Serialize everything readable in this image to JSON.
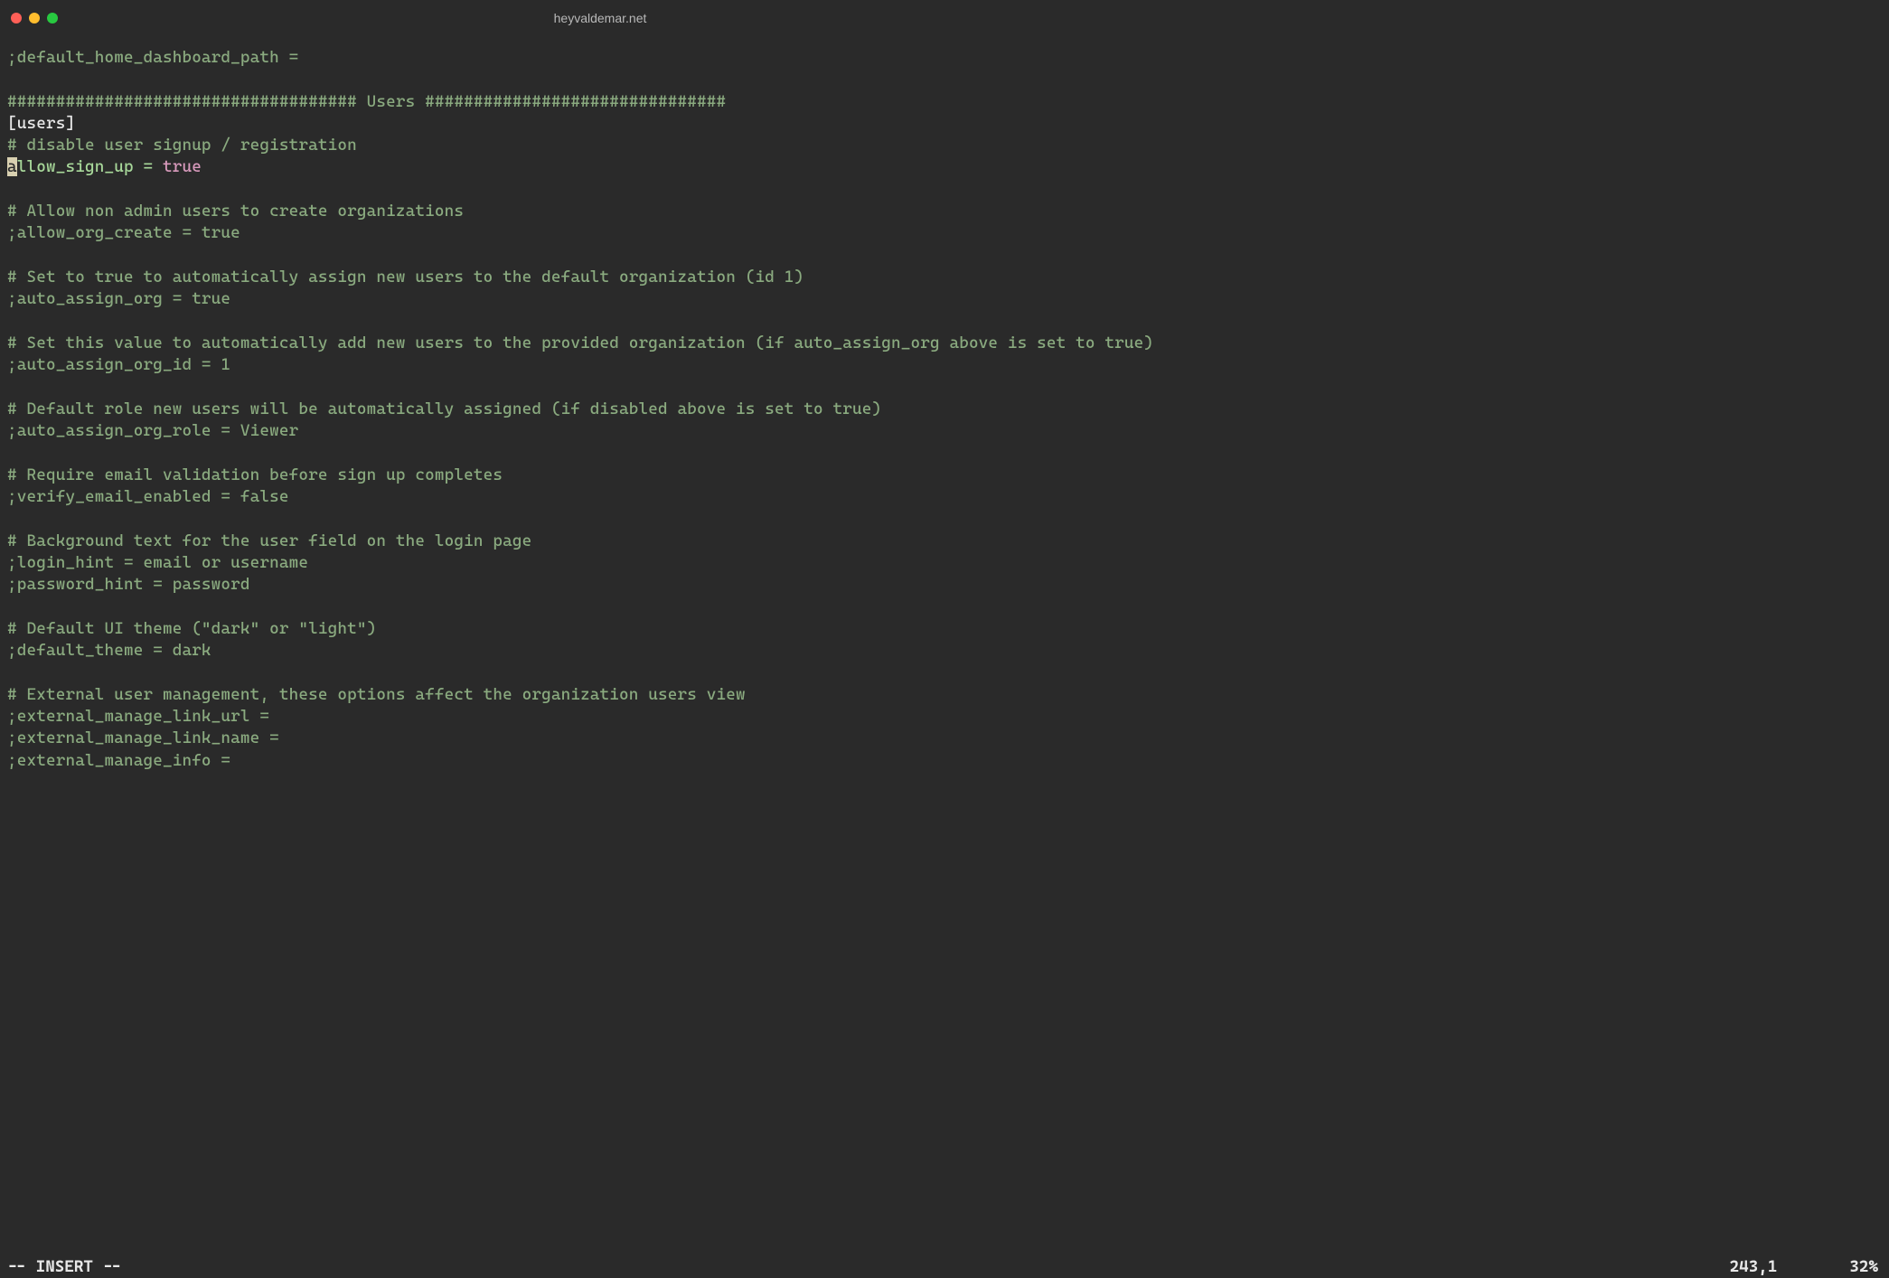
{
  "window": {
    "title": "heyvaldemar.net"
  },
  "editor": {
    "lines": [
      {
        "type": "commented",
        "text": ";default_home_dashboard_path ="
      },
      {
        "type": "blank",
        "text": ""
      },
      {
        "type": "comment",
        "text": "#################################### Users ###############################"
      },
      {
        "type": "section",
        "text": "[users]"
      },
      {
        "type": "comment",
        "text": "# disable user signup / registration"
      },
      {
        "type": "cursor_line",
        "cursor_char": "a",
        "rest_key": "llow_sign_up",
        "eq": " = ",
        "val": "true",
        "val_class": "keyword-true"
      },
      {
        "type": "blank",
        "text": ""
      },
      {
        "type": "comment",
        "text": "# Allow non admin users to create organizations"
      },
      {
        "type": "commented",
        "text": ";allow_org_create = true"
      },
      {
        "type": "blank",
        "text": ""
      },
      {
        "type": "comment",
        "text": "# Set to true to automatically assign new users to the default organization (id 1)"
      },
      {
        "type": "commented",
        "text": ";auto_assign_org = true"
      },
      {
        "type": "blank",
        "text": ""
      },
      {
        "type": "comment",
        "text": "# Set this value to automatically add new users to the provided organization (if auto_assign_org above is set to true)"
      },
      {
        "type": "commented",
        "text": ";auto_assign_org_id = 1"
      },
      {
        "type": "blank",
        "text": ""
      },
      {
        "type": "comment",
        "text": "# Default role new users will be automatically assigned (if disabled above is set to true)"
      },
      {
        "type": "commented",
        "text": ";auto_assign_org_role = Viewer"
      },
      {
        "type": "blank",
        "text": ""
      },
      {
        "type": "comment",
        "text": "# Require email validation before sign up completes"
      },
      {
        "type": "commented",
        "text": ";verify_email_enabled = false"
      },
      {
        "type": "blank",
        "text": ""
      },
      {
        "type": "comment",
        "text": "# Background text for the user field on the login page"
      },
      {
        "type": "commented",
        "text": ";login_hint = email or username"
      },
      {
        "type": "commented",
        "text": ";password_hint = password"
      },
      {
        "type": "blank",
        "text": ""
      },
      {
        "type": "comment",
        "text": "# Default UI theme (\"dark\" or \"light\")"
      },
      {
        "type": "commented",
        "text": ";default_theme = dark"
      },
      {
        "type": "blank",
        "text": ""
      },
      {
        "type": "comment",
        "text": "# External user management, these options affect the organization users view"
      },
      {
        "type": "commented",
        "text": ";external_manage_link_url ="
      },
      {
        "type": "commented",
        "text": ";external_manage_link_name ="
      },
      {
        "type": "commented",
        "text": ";external_manage_info ="
      }
    ]
  },
  "status": {
    "mode": "-- INSERT --",
    "position": "243,1",
    "percent": "32%"
  }
}
